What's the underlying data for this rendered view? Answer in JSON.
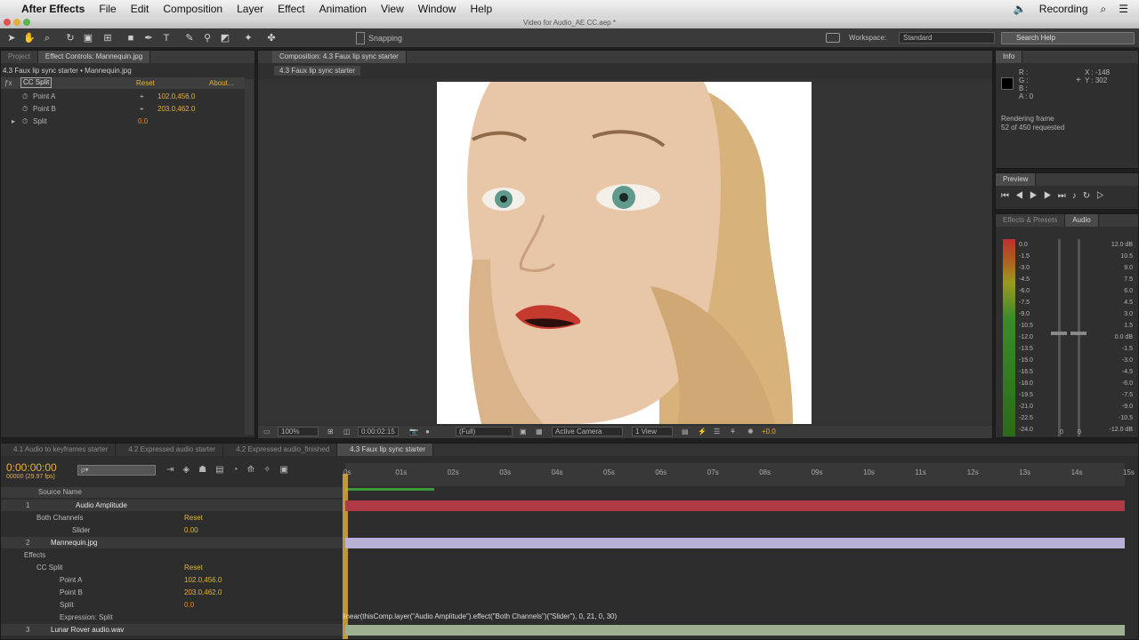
{
  "menubar": {
    "apple": "",
    "items": [
      "After Effects",
      "File",
      "Edit",
      "Composition",
      "Layer",
      "Effect",
      "Animation",
      "View",
      "Window",
      "Help"
    ],
    "status": "Recording"
  },
  "window_title": "Video for Audio_AE CC.aep *",
  "toolbar": {
    "snapping": "Snapping",
    "workspace_label": "Workspace:",
    "workspace_value": "Standard",
    "search_placeholder": "Search Help"
  },
  "effect_panel": {
    "tabs": [
      "Project",
      "Effect Controls: Mannequin.jpg"
    ],
    "header": "4.3 Faux lip sync starter • Mannequin.jpg",
    "effect_name": "CC Split",
    "reset": "Reset",
    "about": "About...",
    "params": [
      {
        "name": "Point A",
        "value": "102.0,456.0"
      },
      {
        "name": "Point B",
        "value": "203.0,462.0"
      },
      {
        "name": "Split",
        "value": "0.0"
      }
    ]
  },
  "comp_panel": {
    "tab": "Composition: 4.3 Faux lip sync starter",
    "subtab": "4.3 Faux lip sync starter",
    "zoom": "100%",
    "timecode": "0:00:02:15",
    "resolution": "(Full)",
    "camera": "Active Camera",
    "views": "1 View",
    "exposure": "+0.0"
  },
  "info_panel": {
    "tab": "Info",
    "r": "R :",
    "g": "G :",
    "b": "B :",
    "a": "A : 0",
    "x": "X : -148",
    "y": "Y : 302",
    "line1": "Rendering frame",
    "line2": "52 of 450 requested"
  },
  "preview_panel": {
    "tab": "Preview"
  },
  "audio_panel": {
    "tabs": [
      "Effects & Presets",
      "Audio"
    ],
    "left_scale": [
      "0.0",
      "-1.5",
      "-3.0",
      "-4.5",
      "-6.0",
      "-7.5",
      "-9.0",
      "-10.5",
      "-12.0",
      "-13.5",
      "-15.0",
      "-16.5",
      "-18.0",
      "-19.5",
      "-21.0",
      "-22.5",
      "-24.0"
    ],
    "right_scale": [
      "12.0 dB",
      "10.5",
      "9.0",
      "7.5",
      "6.0",
      "4.5",
      "3.0",
      "1.5",
      "0.0 dB",
      "-1.5",
      "-3.0",
      "-4.5",
      "-6.0",
      "-7.5",
      "-9.0",
      "-10.5",
      "-12.0 dB"
    ],
    "bottom_values": [
      "0",
      "0"
    ]
  },
  "timeline": {
    "tabs": [
      "4.1 Audio to keyframes starter",
      "4.2 Expressed audio starter",
      "4.2 Expressed audio_finished",
      "4.3 Faux lip sync starter"
    ],
    "timecode": "0:00:00:00",
    "frames": "00000 (29.97 fps)",
    "search_placeholder": "ρ▾",
    "source_name": "Source Name",
    "ruler": [
      "0s",
      "01s",
      "02s",
      "03s",
      "04s",
      "05s",
      "06s",
      "07s",
      "08s",
      "09s",
      "10s",
      "11s",
      "12s",
      "13s",
      "14s",
      "15s"
    ],
    "layers": [
      {
        "num": "1",
        "name": "Audio Amplitude"
      },
      {
        "num": "",
        "name": "Both Channels",
        "value": "Reset"
      },
      {
        "num": "",
        "name": "Slider",
        "value": "0.00"
      },
      {
        "num": "2",
        "name": "Mannequin.jpg"
      },
      {
        "num": "",
        "name": "Effects"
      },
      {
        "num": "",
        "name": "CC Split",
        "value": "Reset"
      },
      {
        "num": "",
        "name": "Point A",
        "value": "102.0,456.0"
      },
      {
        "num": "",
        "name": "Point B",
        "value": "203.0,462.0"
      },
      {
        "num": "",
        "name": "Split",
        "value": "0.0"
      },
      {
        "num": "",
        "name": "Expression: Split"
      },
      {
        "num": "3",
        "name": "Lunar Rover audio.wav"
      }
    ],
    "expression": "linear(thisComp.layer(\"Audio Amplitude\").effect(\"Both Channels\")(\"Slider\"), 0, 21, 0, 30)",
    "fx": "fx"
  },
  "colors": {
    "accent": "#e3b23c",
    "track_red": "#b03a45",
    "track_lavender": "#b9b0d8",
    "track_green": "#9fb092"
  }
}
